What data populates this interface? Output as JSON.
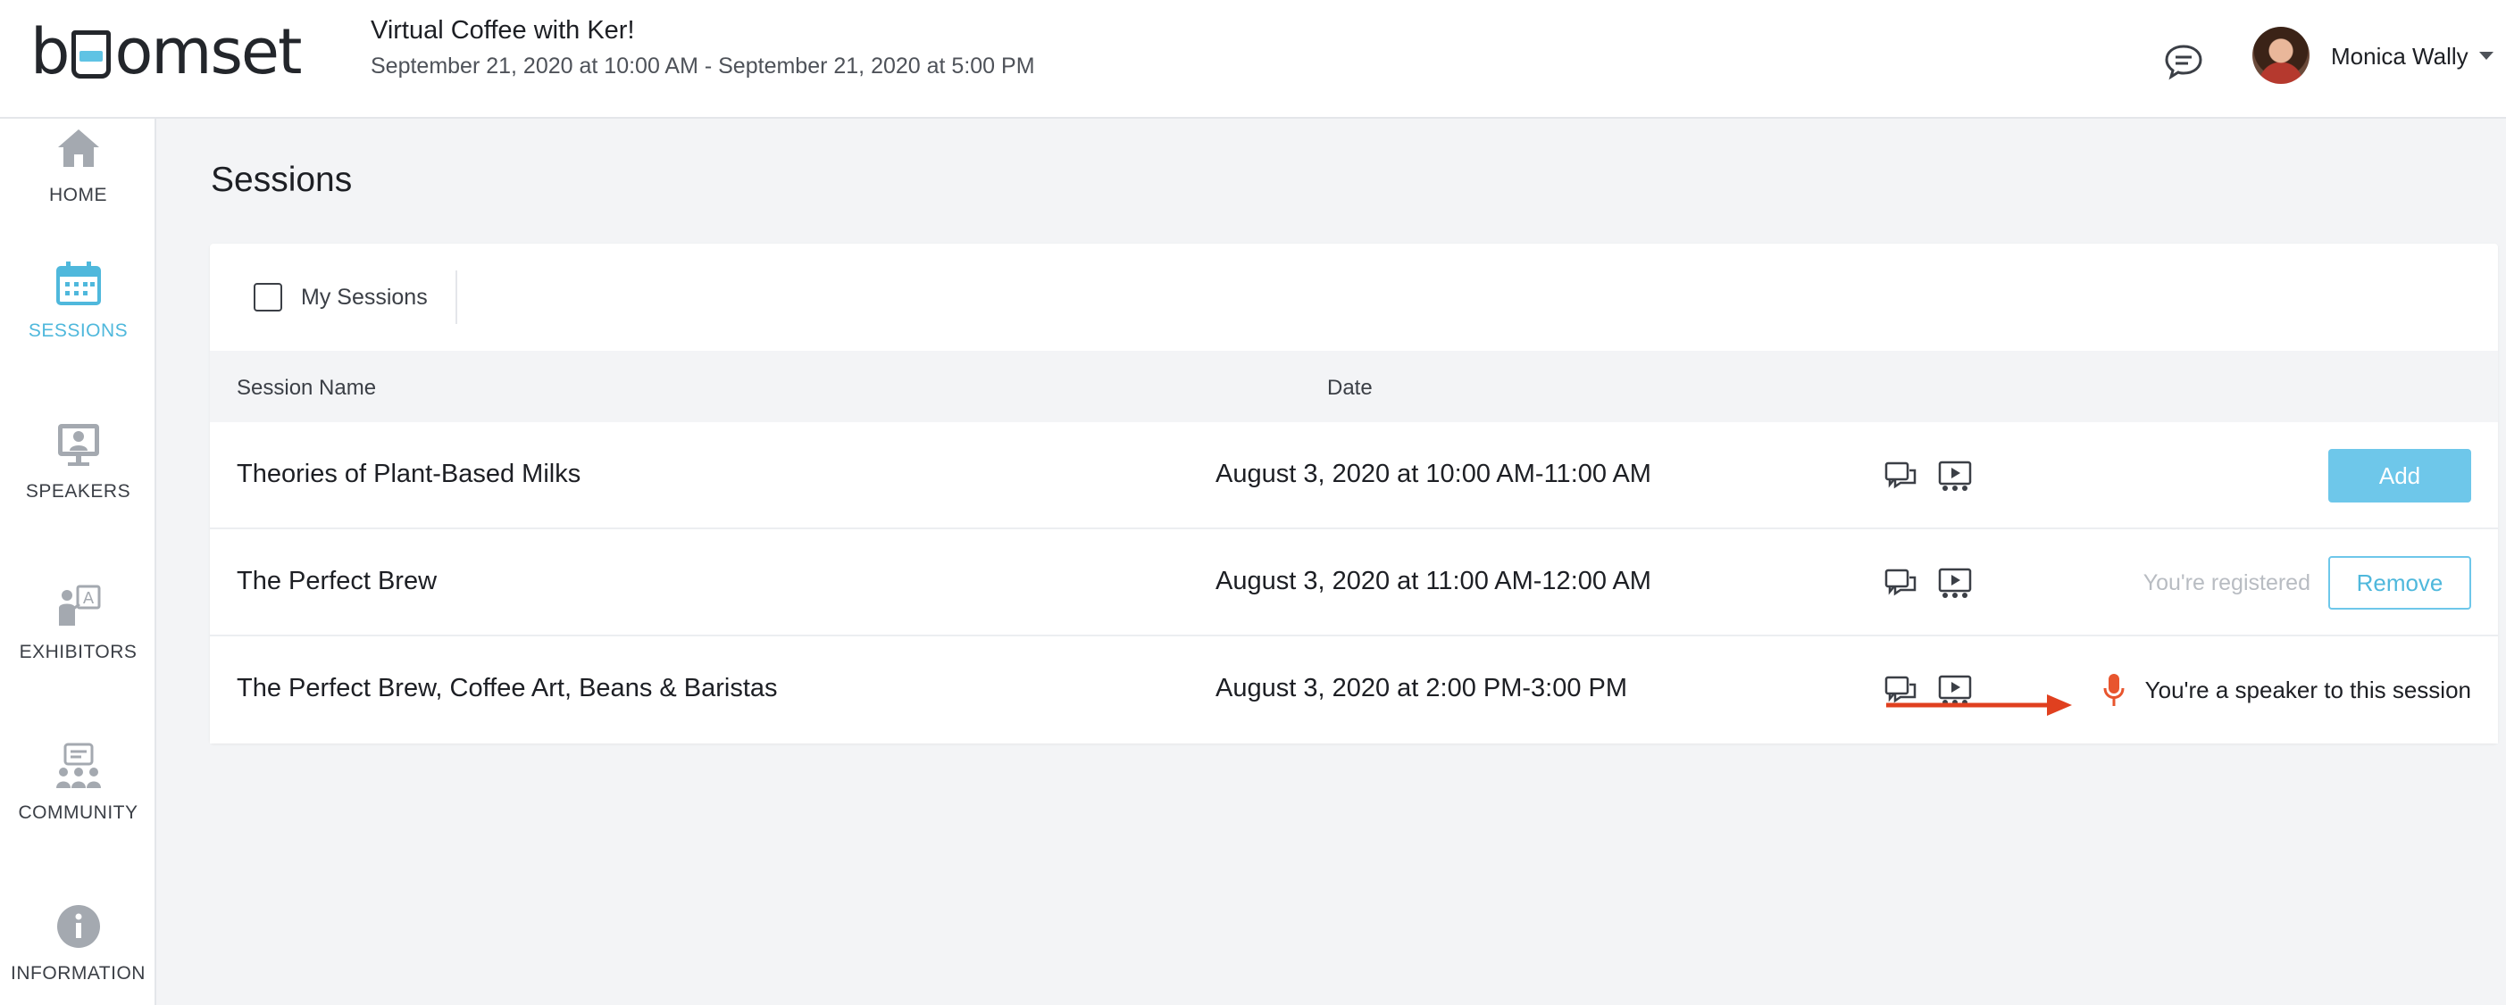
{
  "header": {
    "logo_text_prefix": "b",
    "logo_text_suffix": "omset",
    "event_title": "Virtual Coffee with Ker!",
    "event_dates": "September 21, 2020 at 10:00 AM - September 21, 2020 at 5:00 PM",
    "chat_icon": "chat-bubble-icon",
    "user_name": "Monica Wally",
    "accent_color": "#4fb8dc"
  },
  "sidebar": {
    "items": [
      {
        "label": "HOME",
        "icon": "home-icon",
        "active": false
      },
      {
        "label": "SESSIONS",
        "icon": "calendar-icon",
        "active": true
      },
      {
        "label": "SPEAKERS",
        "icon": "presenter-icon",
        "active": false
      },
      {
        "label": "EXHIBITORS",
        "icon": "exhibitor-icon",
        "active": false
      },
      {
        "label": "COMMUNITY",
        "icon": "community-icon",
        "active": false
      },
      {
        "label": "INFORMATION",
        "icon": "info-icon",
        "active": false
      }
    ]
  },
  "main": {
    "title": "Sessions",
    "filter": {
      "label": "My Sessions",
      "checked": false
    },
    "columns": {
      "name": "Session Name",
      "date": "Date"
    },
    "sessions": [
      {
        "name": "Theories of Plant-Based Milks",
        "date": "August 3, 2020 at 10:00 AM-11:00 AM",
        "action_label": "Add"
      },
      {
        "name": "The Perfect Brew",
        "date": "August 3, 2020 at 11:00 AM-12:00 AM",
        "status_label": "You're registered",
        "action_label": "Remove"
      },
      {
        "name": "The Perfect Brew, Coffee Art, Beans & Baristas",
        "date": "August 3, 2020 at 2:00 PM-3:00 PM",
        "speaker_label": "You're a speaker to this session"
      }
    ],
    "speaker_color": "#e8552e",
    "arrow_color": "#e0401f"
  }
}
